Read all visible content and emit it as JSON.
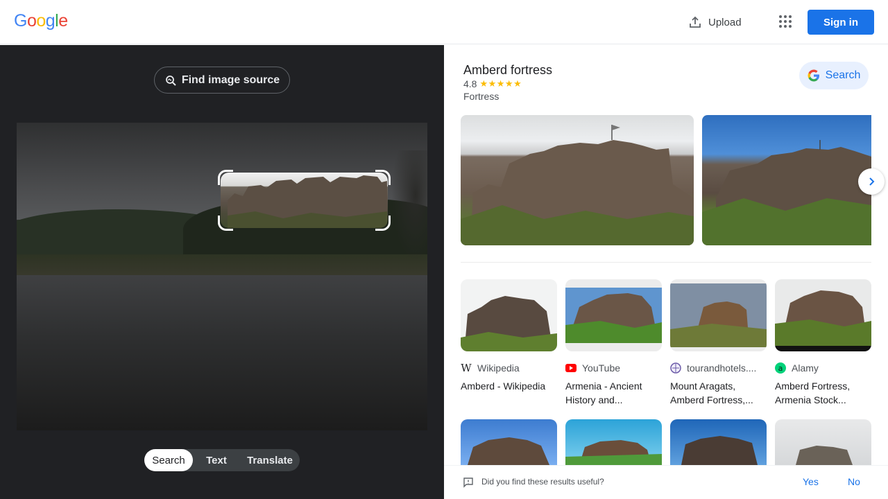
{
  "header": {
    "logo_letters": [
      {
        "ch": "G",
        "color": "#4285f4"
      },
      {
        "ch": "o",
        "color": "#ea4335"
      },
      {
        "ch": "o",
        "color": "#fbbc05"
      },
      {
        "ch": "g",
        "color": "#4285f4"
      },
      {
        "ch": "l",
        "color": "#34a853"
      },
      {
        "ch": "e",
        "color": "#ea4335"
      }
    ],
    "upload_label": "Upload",
    "apps_icon": "apps-grid-icon",
    "signin_label": "Sign in"
  },
  "lens": {
    "find_source_label": "Find image source",
    "modes": [
      "Search",
      "Text",
      "Translate"
    ],
    "active_mode": "Search"
  },
  "knowledge_panel": {
    "title": "Amberd fortress",
    "rating": "4.8",
    "stars": "★★★★★",
    "type": "Fortress",
    "search_label": "Search"
  },
  "results": [
    {
      "source": "Wikipedia",
      "source_icon": "wikipedia-icon",
      "title": "Amberd - Wikipedia"
    },
    {
      "source": "YouTube",
      "source_icon": "youtube-icon",
      "title": "Armenia - Ancient History and..."
    },
    {
      "source": "tourandhotels....",
      "source_icon": "tourandhotels-icon",
      "title": "Mount Aragats, Amberd Fortress,..."
    },
    {
      "source": "Alamy",
      "source_icon": "alamy-icon",
      "title": "Amberd Fortress, Armenia Stock..."
    }
  ],
  "feedback": {
    "question": "Did you find these results useful?",
    "yes": "Yes",
    "no": "No"
  },
  "colors": {
    "accent": "#1a73e8",
    "dark_pane": "#202124",
    "star": "#fbbc04"
  }
}
